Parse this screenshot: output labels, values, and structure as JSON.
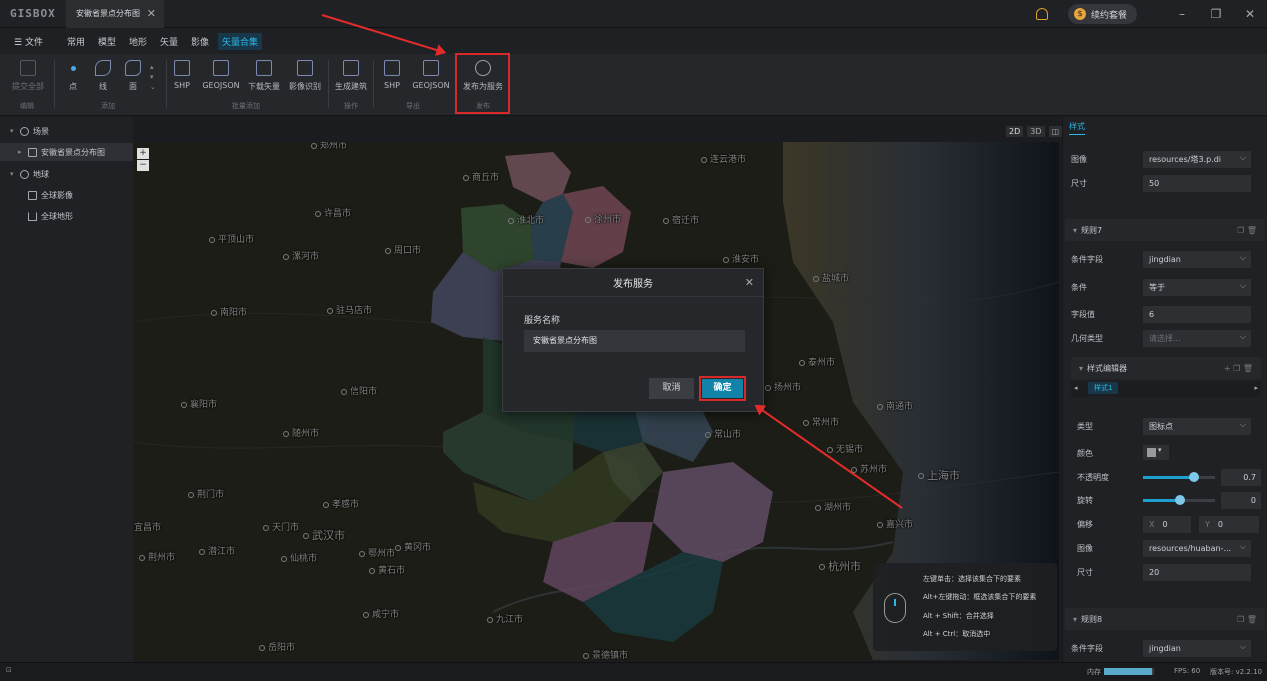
{
  "app": {
    "logo": "GISBOX",
    "tab_title": "安徽省景点分布图",
    "plan_button": "续约套餐"
  },
  "menu": {
    "file": "文件",
    "items": [
      "常用",
      "模型",
      "地形",
      "矢量",
      "影像",
      "矢量合集"
    ],
    "active_index": 5
  },
  "ribbon": {
    "buttons": {
      "submit_all": "提交全部",
      "point": "点",
      "line": "线",
      "polygon": "面",
      "shp_batch": "SHP",
      "geojson_batch": "GEOJSON",
      "download_vector": "下载矢量",
      "image_recognition": "影像识别",
      "generate_building": "生成建筑",
      "shp_export": "SHP",
      "geojson_export": "GEOJSON",
      "publish_service": "发布为服务"
    },
    "groups": {
      "edit": "编辑",
      "add": "添加",
      "batch_add": "批量添加",
      "operation": "操作",
      "export": "导出",
      "publish": "发布"
    }
  },
  "tree": {
    "scene": "场景",
    "scene_layer": "安徽省景点分布图",
    "globe": "地球",
    "global_imagery": "全球影像",
    "global_terrain": "全球地形"
  },
  "view_modes": [
    "2D",
    "3D"
  ],
  "map": {
    "cities": [
      "郑州市",
      "商丘市",
      "徐州市",
      "连云港市",
      "许昌市",
      "淮北市",
      "宿迁市",
      "平顶山市",
      "漯河市",
      "周口市",
      "淮安市",
      "盐城市",
      "南阳市",
      "驻马店市",
      "泰州市",
      "信阳市",
      "扬州市",
      "南通市",
      "襄阳市",
      "随州市",
      "常州市",
      "无锡市",
      "苏州市",
      "上海市",
      "孝感市",
      "荆门市",
      "天门市",
      "武汉市",
      "黄冈市",
      "湖州市",
      "嘉兴市",
      "荆州市",
      "潜江市",
      "仙桃市",
      "鄂州市",
      "黄石市",
      "杭州市",
      "咸宁市",
      "九江市",
      "岳阳市",
      "景德镇市",
      "宜昌市",
      "常山市"
    ]
  },
  "dialog": {
    "title": "发布服务",
    "field_label": "服务名称",
    "field_value": "安徽省景点分布图",
    "cancel": "取消",
    "confirm": "确定"
  },
  "tips": [
    "左键单击：选择该集合下的要素",
    "Alt+左键拖动：框选该集合下的要素",
    "Alt + Shift：合并选择",
    "Alt + Ctrl：取消选中"
  ],
  "right_panel": {
    "tab": "样式",
    "image_label": "图像",
    "image_value_1": "resources/塔3.p.di",
    "size_label": "尺寸",
    "size_value_1": "50",
    "rule7": "规则7",
    "cond_field_label": "条件字段",
    "cond_field_value": "jingdian",
    "condition_label": "条件",
    "condition_value": "等于",
    "field_value_label": "字段值",
    "field_value_value": "6",
    "geom_label": "几何类型",
    "geom_placeholder": "请选择...",
    "style_editor": "样式编辑器",
    "style_tab": "样式1",
    "type_label": "类型",
    "type_value": "图标点",
    "color_label": "颜色",
    "opacity_label": "不透明度",
    "opacity_value": "0.7",
    "rotation_label": "旋转",
    "rotation_value": "0",
    "offset_label": "偏移",
    "offset_x_label": "X",
    "offset_x": "0",
    "offset_y_label": "Y",
    "offset_y": "0",
    "image_value_2": "resources/huaban-...",
    "size_value_2": "20",
    "rule8": "规则8",
    "cond_field_value_2": "jingdian"
  },
  "status": {
    "memory_label": "内存",
    "fps": "FPS: 60",
    "version": "版本号: v2.2.10"
  },
  "colors": {
    "accent": "#2ab6e8",
    "highlight_red": "#d8282a",
    "confirm_blue": "#1283a8"
  }
}
